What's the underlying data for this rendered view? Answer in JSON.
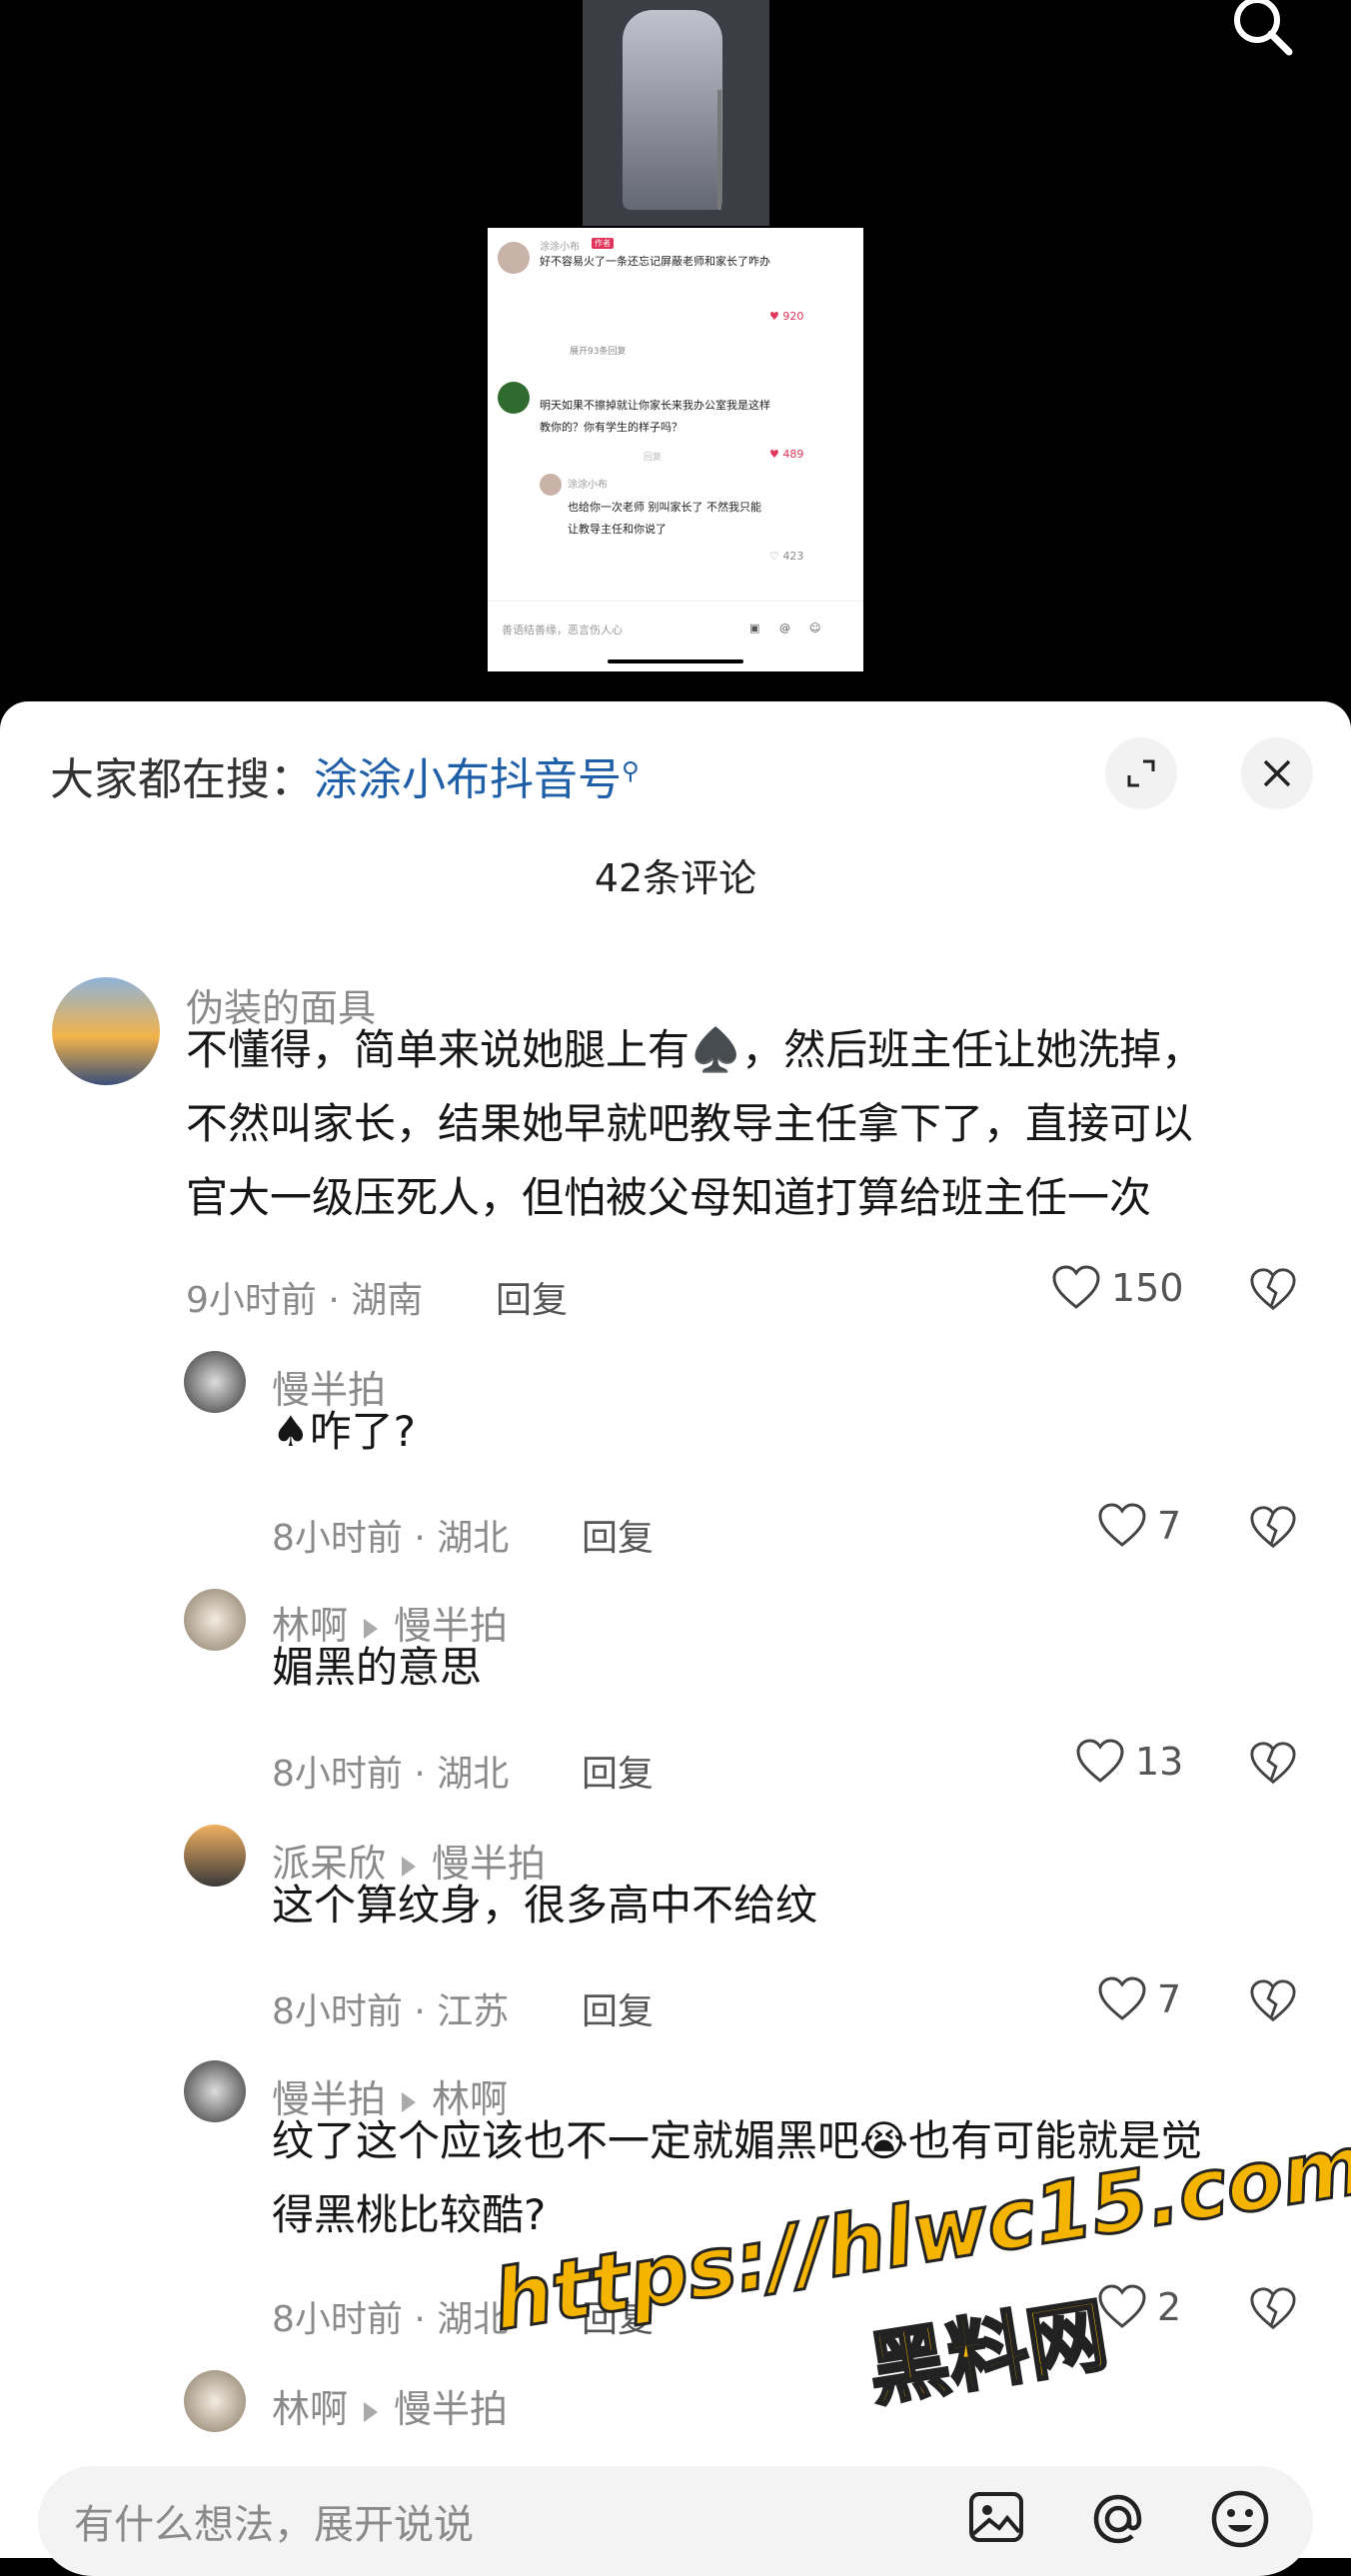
{
  "inner_screenshot": {
    "comment1": {
      "name": "涂涂小布",
      "badge": "作者",
      "text": "好不容易火了一条还忘记屏蔽老师和家长了咋办",
      "likes": "920"
    },
    "expand": "展开93条回复",
    "comment2": {
      "text1": "明天如果不擦掉就让你家长来我办公室我是这样",
      "text2": "教你的？你有学生的样子吗？",
      "likes": "489",
      "reply_label": "回复"
    },
    "comment3": {
      "name": "涂涂小布",
      "text1": "也给你一次老师 别叫家长了 不然我只能",
      "text2": "让教导主任和你说了",
      "likes": "423"
    },
    "input_placeholder": "善语结善缘，恶言伤人心"
  },
  "search_hint": {
    "prefix": "大家都在搜：",
    "keyword": "涂涂小布抖音号"
  },
  "comment_count": "42条评论",
  "comments": [
    {
      "user": "伪装的面具",
      "reply_to": "",
      "lines": [
        "不懂得，简单来说她腿上有♠️，然后班主任让她洗掉，",
        "不然叫家长，结果她早就吧教导主任拿下了，直接可以",
        "官大一级压死人，但怕被父母知道打算给班主任一次"
      ],
      "time": "9小时前 · 湖南",
      "reply_label": "回复",
      "likes": "150"
    },
    {
      "user": "慢半拍",
      "reply_to": "",
      "lines": [
        "♠咋了?"
      ],
      "time": "8小时前 · 湖北",
      "reply_label": "回复",
      "likes": "7"
    },
    {
      "user": "林啊",
      "reply_to": "慢半拍",
      "lines": [
        "媚黑的意思"
      ],
      "time": "8小时前 · 湖北",
      "reply_label": "回复",
      "likes": "13"
    },
    {
      "user": "派呆欣",
      "reply_to": "慢半拍",
      "lines": [
        "这个算纹身，很多高中不给纹"
      ],
      "time": "8小时前 · 江苏",
      "reply_label": "回复",
      "likes": "7"
    },
    {
      "user": "慢半拍",
      "reply_to": "林啊",
      "lines": [
        "纹了这个应该也不一定就媚黑吧😭也有可能就是觉",
        "得黑桃比较酷?"
      ],
      "time": "8小时前 · 湖北",
      "reply_label": "回复",
      "likes": "2"
    },
    {
      "user": "林啊",
      "reply_to": "慢半拍"
    }
  ],
  "bottom_input": {
    "placeholder": "有什么想法，展开说说"
  },
  "watermark": {
    "line1": "https://hlwc15.com",
    "line2": "黑料网"
  },
  "colors": {
    "keyword": "#1f5fa8",
    "watermark": "#f4b400",
    "like_red": "#e0345a"
  }
}
